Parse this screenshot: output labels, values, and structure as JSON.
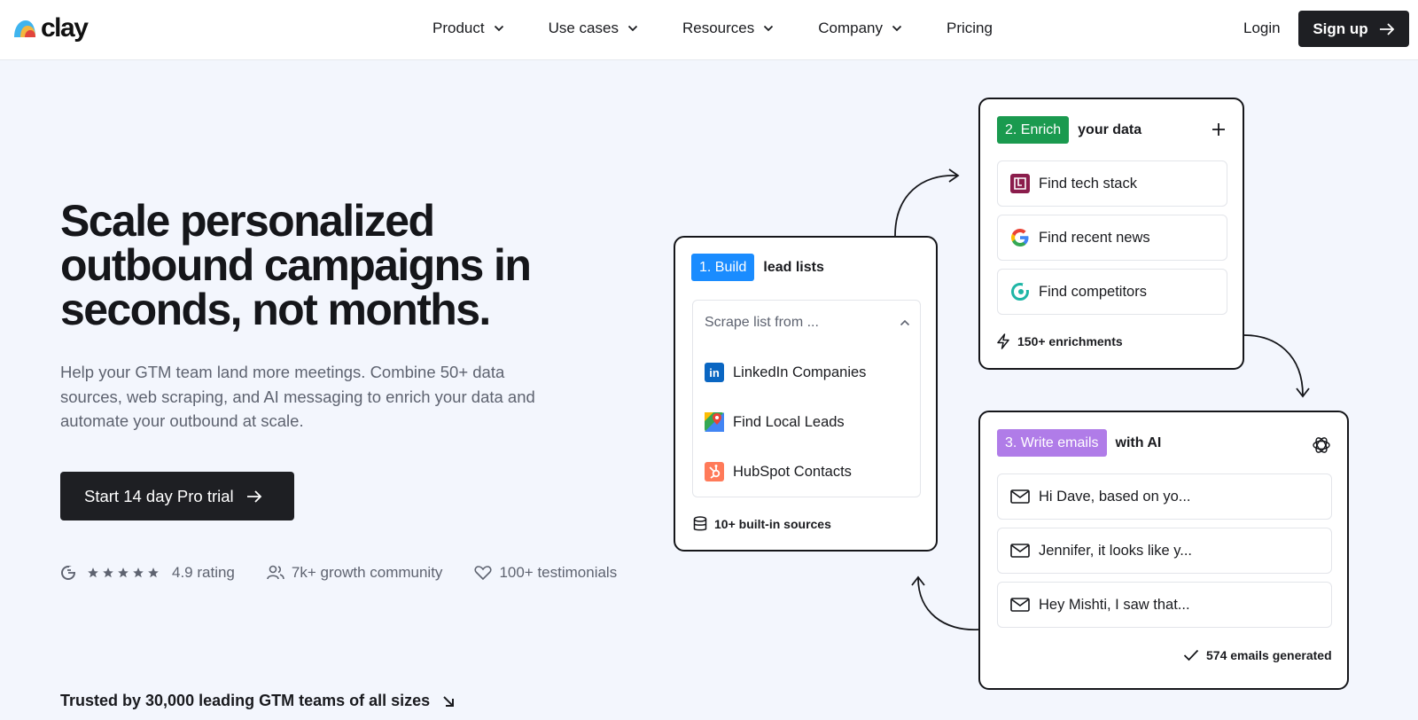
{
  "brand": {
    "name": "clay"
  },
  "nav": {
    "items": [
      {
        "label": "Product",
        "dropdown": true
      },
      {
        "label": "Use cases",
        "dropdown": true
      },
      {
        "label": "Resources",
        "dropdown": true
      },
      {
        "label": "Company",
        "dropdown": true
      },
      {
        "label": "Pricing",
        "dropdown": false
      }
    ],
    "login": "Login",
    "signup": "Sign up"
  },
  "hero": {
    "title": "Scale personalized outbound campaigns in seconds, not months.",
    "subtitle": "Help your GTM team land more meetings. Combine 50+ data sources, web scraping, and AI messaging to enrich your data and automate your outbound at scale.",
    "cta": "Start 14 day Pro trial",
    "stats": {
      "rating": "4.9 rating",
      "stars": 5,
      "community": "7k+ growth community",
      "testimonials": "100+ testimonials"
    },
    "trusted": "Trusted by 30,000 leading GTM teams of all sizes"
  },
  "build": {
    "tag": "1. Build",
    "text": "lead lists",
    "dropdown_label": "Scrape list from ...",
    "sources": [
      "LinkedIn Companies",
      "Find Local Leads",
      "HubSpot Contacts"
    ],
    "footer": "10+ built-in sources"
  },
  "enrich": {
    "tag": "2. Enrich",
    "text": "your data",
    "items": [
      "Find tech stack",
      "Find recent news",
      "Find competitors"
    ],
    "footer": "150+ enrichments"
  },
  "write": {
    "tag": "3. Write emails",
    "text": "with AI",
    "emails": [
      "Hi Dave, based on yo...",
      "Jennifer, it looks like y...",
      "Hey Mishti, I saw that..."
    ],
    "footer": "574 emails generated"
  },
  "colors": {
    "build_tag": "#1a8cff",
    "enrich_tag": "#1a9a4f",
    "write_tag": "#b07ce8",
    "background": "#f3f6fd",
    "dark": "#1e1f23"
  }
}
